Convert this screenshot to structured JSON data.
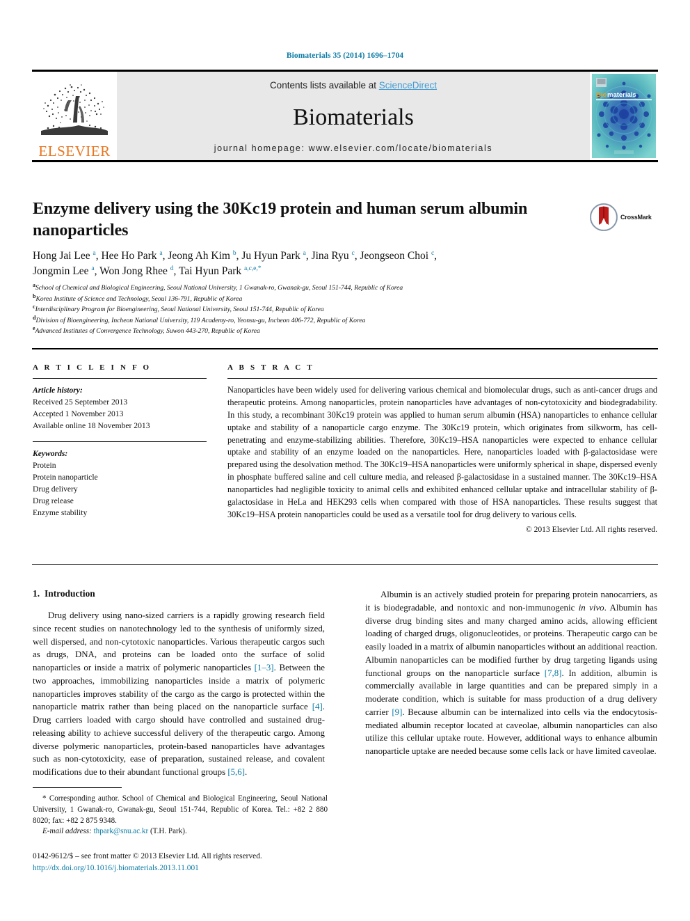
{
  "running_head": "Biomaterials 35 (2014) 1696–1704",
  "header": {
    "contents_prefix": "Contents lists available at ",
    "sciencedirect": "ScienceDirect",
    "journal_title": "Biomaterials",
    "homepage": "journal homepage: www.elsevier.com/locate/biomaterials",
    "publisher_logo_text": "ELSEVIER",
    "cover_title_bio": "Bio",
    "cover_title_rest": "materials",
    "accent_link_color": "#3f9bd4",
    "accent_teal_color": "#0b7aa5",
    "elsevier_orange": "#E87722"
  },
  "crossmark": {
    "label": "CrossMark"
  },
  "title": "Enzyme delivery using the 30Kc19 protein and human serum albumin nanoparticles",
  "authors_line_1": "Hong Jai Lee a, Hee Ho Park a, Jeong Ah Kim b, Ju Hyun Park a, Jina Ryu c, Jeongseon Choi c,",
  "authors_line_2": "Jongmin Lee a, Won Jong Rhee d, Tai Hyun Park a,c,e,*",
  "authors": [
    {
      "name": "Hong Jai Lee",
      "sup": "a"
    },
    {
      "name": "Hee Ho Park",
      "sup": "a"
    },
    {
      "name": "Jeong Ah Kim",
      "sup": "b"
    },
    {
      "name": "Ju Hyun Park",
      "sup": "a"
    },
    {
      "name": "Jina Ryu",
      "sup": "c"
    },
    {
      "name": "Jeongseon Choi",
      "sup": "c"
    },
    {
      "name": "Jongmin Lee",
      "sup": "a"
    },
    {
      "name": "Won Jong Rhee",
      "sup": "d"
    },
    {
      "name": "Tai Hyun Park",
      "sup": "a,c,e,*"
    }
  ],
  "affiliations": [
    {
      "marker": "a",
      "text": "School of Chemical and Biological Engineering, Seoul National University, 1 Gwanak-ro, Gwanak-gu, Seoul 151-744, Republic of Korea"
    },
    {
      "marker": "b",
      "text": "Korea Institute of Science and Technology, Seoul 136-791, Republic of Korea"
    },
    {
      "marker": "c",
      "text": "Interdisciplinary Program for Bioengineering, Seoul National University, Seoul 151-744, Republic of Korea"
    },
    {
      "marker": "d",
      "text": "Division of Bioengineering, Incheon National University, 119 Academy-ro, Yeonsu-gu, Incheon 406-772, Republic of Korea"
    },
    {
      "marker": "e",
      "text": "Advanced Institutes of Convergence Technology, Suwon 443-270, Republic of Korea"
    }
  ],
  "article_info": {
    "heading": "A R T I C L E   I N F O",
    "history_label": "Article history:",
    "history": [
      "Received 25 September 2013",
      "Accepted 1 November 2013",
      "Available online 18 November 2013"
    ],
    "keywords_label": "Keywords:",
    "keywords": [
      "Protein",
      "Protein nanoparticle",
      "Drug delivery",
      "Drug release",
      "Enzyme stability"
    ]
  },
  "abstract": {
    "heading": "A B S T R A C T",
    "text": "Nanoparticles have been widely used for delivering various chemical and biomolecular drugs, such as anti-cancer drugs and therapeutic proteins. Among nanoparticles, protein nanoparticles have advantages of non-cytotoxicity and biodegradability. In this study, a recombinant 30Kc19 protein was applied to human serum albumin (HSA) nanoparticles to enhance cellular uptake and stability of a nanoparticle cargo enzyme. The 30Kc19 protein, which originates from silkworm, has cell-penetrating and enzyme-stabilizing abilities. Therefore, 30Kc19–HSA nanoparticles were expected to enhance cellular uptake and stability of an enzyme loaded on the nanoparticles. Here, nanoparticles loaded with β-galactosidase were prepared using the desolvation method. The 30Kc19–HSA nanoparticles were uniformly spherical in shape, dispersed evenly in phosphate buffered saline and cell culture media, and released β-galactosidase in a sustained manner. The 30Kc19–HSA nanoparticles had negligible toxicity to animal cells and exhibited enhanced cellular uptake and intracellular stability of β-galactosidase in HeLa and HEK293 cells when compared with those of HSA nanoparticles. These results suggest that 30Kc19–HSA protein nanoparticles could be used as a versatile tool for drug delivery to various cells.",
    "copyright": "© 2013 Elsevier Ltd. All rights reserved."
  },
  "introduction": {
    "number": "1.",
    "heading": "Introduction",
    "para_1_a": "Drug delivery using nano-sized carriers is a rapidly growing research field since recent studies on nanotechnology led to the synthesis of uniformly sized, well dispersed, and non-cytotoxic nanoparticles. Various therapeutic cargos such as drugs, DNA, and proteins can be loaded onto the surface of solid nanoparticles or inside a matrix of polymeric nanoparticles ",
    "ref_1_3": "[1–3]",
    "para_1_b": ". Between the two approaches, immobilizing nanoparticles inside a matrix of polymeric nanoparticles improves stability of the cargo as the cargo is protected within the nanoparticle matrix rather than being placed on the nanoparticle surface ",
    "ref_4": "[4]",
    "para_1_c": ". Drug carriers loaded with cargo should have controlled and sustained drug-releasing ability to achieve successful delivery of the therapeutic cargo. Among diverse polymeric nanoparticles, protein-based nanoparticles have advantages such as non-cytotoxicity, ease of preparation, sustained release, and covalent modifications due to their abundant functional groups ",
    "ref_5_6": "[5,6]",
    "para_1_d": ".",
    "para_2_a": "Albumin is an actively studied protein for preparing protein nanocarriers, as it is biodegradable, and nontoxic and non-immunogenic ",
    "in_vivo": "in vivo",
    "para_2_b": ". Albumin has diverse drug binding sites and many charged amino acids, allowing efficient loading of charged drugs, oligonucleotides, or proteins. Therapeutic cargo can be easily loaded in a matrix of albumin nanoparticles without an additional reaction. Albumin nanoparticles can be modified further by drug targeting ligands using functional groups on the nanoparticle surface ",
    "ref_7_8": "[7,8]",
    "para_2_c": ". In addition, albumin is commercially available in large quantities and can be prepared simply in a moderate condition, which is suitable for mass production of a drug delivery carrier ",
    "ref_9": "[9]",
    "para_2_d": ". Because albumin can be internalized into cells via the endocytosis-mediated albumin receptor located at caveolae, albumin nanoparticles can also utilize this cellular uptake route. However, additional ways to enhance albumin nanoparticle uptake are needed because some cells lack or have limited caveolae."
  },
  "footnote": {
    "corresponding": "* Corresponding author. School of Chemical and Biological Engineering, Seoul National University, 1 Gwanak-ro, Gwanak-gu, Seoul 151-744, Republic of Korea. Tel.: +82 2 880 8020; fax: +82 2 875 9348.",
    "email_label": "E-mail address:",
    "email": "thpark@snu.ac.kr",
    "email_owner": "(T.H. Park)."
  },
  "issn": {
    "line": "0142-9612/$ – see front matter © 2013 Elsevier Ltd. All rights reserved.",
    "doi": "http://dx.doi.org/10.1016/j.biomaterials.2013.11.001"
  }
}
